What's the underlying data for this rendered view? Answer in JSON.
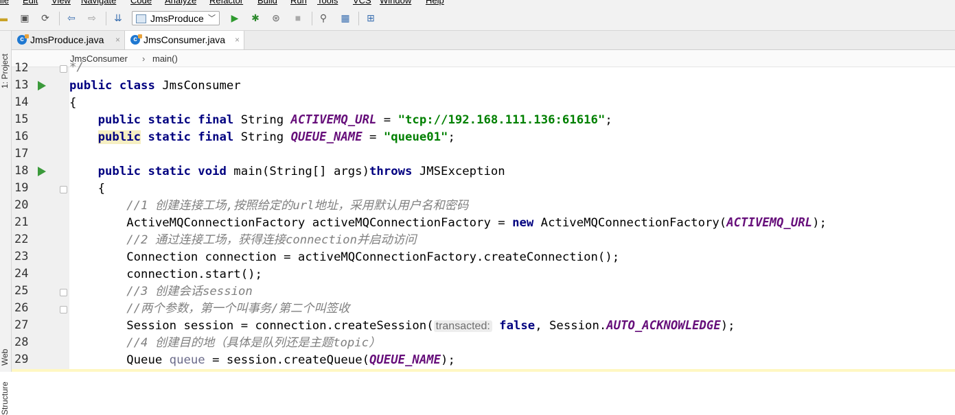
{
  "menu": [
    "File",
    "Edit",
    "View",
    "Navigate",
    "Code",
    "Analyze",
    "Refactor",
    "Build",
    "Run",
    "Tools",
    "VCS",
    "Window",
    "Help"
  ],
  "toolbar": {
    "run_config": "JmsProduce"
  },
  "side_tools": {
    "project": "1: Project",
    "web": "Web",
    "structure": "Structure"
  },
  "tabs": [
    {
      "label": "JmsProduce.java",
      "active": false
    },
    {
      "label": "JmsConsumer.java",
      "active": true
    }
  ],
  "breadcrumb": [
    "JmsConsumer",
    "main()"
  ],
  "line_numbers": [
    "12",
    "13",
    "14",
    "15",
    "16",
    "17",
    "18",
    "19",
    "20",
    "21",
    "22",
    "23",
    "24",
    "25",
    "26",
    "27",
    "28",
    "29"
  ],
  "code": {
    "l12": "*/",
    "l13_kw": "public class",
    "l13_name": " JmsConsumer",
    "l14": "{",
    "l15_kw": "public static final",
    "l15_type": " String ",
    "l15_field": "ACTIVEMQ_URL",
    "l15_eq": " = ",
    "l15_str": "\"tcp://192.168.111.136:61616\"",
    "l15_end": ";",
    "l16_kw1": "public",
    "l16_kw2": " static final",
    "l16_type": " String ",
    "l16_field": "QUEUE_NAME",
    "l16_eq": " = ",
    "l16_str": "\"queue01\"",
    "l16_end": ";",
    "l18_kw": "public static void",
    "l18_mid": " main(String[] args)",
    "l18_kw2": "throws",
    "l18_end": " JMSException",
    "l19": "{",
    "l20": "//1 创建连接工场,按照给定的url地址，采用默认用户名和密码",
    "l21_a": "ActiveMQConnectionFactory activeMQConnectionFactory = ",
    "l21_kw": "new",
    "l21_b": " ActiveMQConnectionFactory(",
    "l21_field": "ACTIVEMQ_URL",
    "l21_end": ");",
    "l22": "//2 通过连接工场，获得连接connection并启动访问",
    "l23": "Connection connection = activeMQConnectionFactory.createConnection();",
    "l24": "connection.start();",
    "l25": "//3 创建会话session",
    "l26": "//两个参数，第一个叫事务/第二个叫签收",
    "l27_a": "Session session = connection.createSession(",
    "l27_hint": "transacted:",
    "l27_kw": " false",
    "l27_b": ", Session.",
    "l27_field": "AUTO_ACKNOWLEDGE",
    "l27_end": ");",
    "l28": "//4 创建目的地（具体是队列还是主题topic）",
    "l29_a": "Queue ",
    "l29_var": "queue",
    "l29_b": " = session.createQueue(",
    "l29_field": "QUEUE_NAME",
    "l29_end": ");"
  }
}
